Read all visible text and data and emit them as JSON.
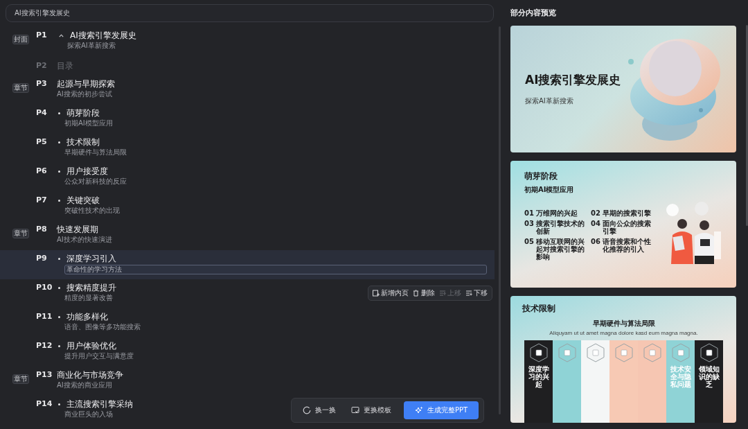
{
  "title_field": {
    "value": "AI搜索引擎发展史"
  },
  "outline": [
    {
      "badge": "封面",
      "page": "P1",
      "kind": "cover",
      "title": "AI搜索引擎发展史",
      "subtitle": "探索AI革新搜索",
      "disabled": false,
      "selected": false
    },
    {
      "page": "P2",
      "kind": "toc",
      "title": "目录",
      "disabled": true,
      "selected": false
    },
    {
      "badge": "章节",
      "page": "P3",
      "kind": "chapter",
      "title": "起源与早期探索",
      "subtitle": "AI搜索的初步尝试",
      "disabled": false,
      "selected": false
    },
    {
      "page": "P4",
      "kind": "section",
      "title": "萌芽阶段",
      "subtitle": "初期AI模型应用",
      "disabled": false,
      "selected": false
    },
    {
      "page": "P5",
      "kind": "section",
      "title": "技术限制",
      "subtitle": "早期硬件与算法局限",
      "disabled": false,
      "selected": false
    },
    {
      "page": "P6",
      "kind": "section",
      "title": "用户接受度",
      "subtitle": "公众对新科技的反应",
      "disabled": false,
      "selected": false
    },
    {
      "page": "P7",
      "kind": "section",
      "title": "关键突破",
      "subtitle": "突破性技术的出现",
      "disabled": false,
      "selected": false
    },
    {
      "badge": "章节",
      "page": "P8",
      "kind": "chapter",
      "title": "快速发展期",
      "subtitle": "AI技术的快速演进",
      "disabled": false,
      "selected": false
    },
    {
      "page": "P9",
      "kind": "section",
      "title": "深度学习引入",
      "subtitle": "革命性的学习方法",
      "disabled": false,
      "selected": true
    },
    {
      "page": "P10",
      "kind": "section",
      "title": "搜索精度提升",
      "subtitle": "精度的显著改善",
      "disabled": false,
      "selected": false
    },
    {
      "page": "P11",
      "kind": "section",
      "title": "功能多样化",
      "subtitle": "语音、图像等多功能搜索",
      "disabled": false,
      "selected": false
    },
    {
      "page": "P12",
      "kind": "section",
      "title": "用户体验优化",
      "subtitle": "提升用户交互与满意度",
      "disabled": false,
      "selected": false
    },
    {
      "badge": "章节",
      "page": "P13",
      "kind": "chapter",
      "title": "商业化与市场竞争",
      "subtitle": "AI搜索的商业应用",
      "disabled": false,
      "selected": false
    },
    {
      "page": "P14",
      "kind": "section",
      "title": "主流搜索引擎采纳",
      "subtitle": "商业巨头的入场",
      "disabled": false,
      "selected": false
    }
  ],
  "row_toolbar": [
    {
      "label": "新增内页",
      "kind": "add",
      "disabled": false
    },
    {
      "label": "删除",
      "kind": "delete",
      "disabled": false
    },
    {
      "label": "上移",
      "kind": "up",
      "disabled": true
    },
    {
      "label": "下移",
      "kind": "down",
      "disabled": false
    }
  ],
  "action_bar": [
    {
      "label": "换一换",
      "kind": "refresh"
    },
    {
      "label": "更换模板",
      "kind": "template"
    },
    {
      "label": "生成完整PPT",
      "kind": "generate"
    }
  ],
  "preview": {
    "title": "部分内容预览",
    "slides": [
      {
        "kind": "cover",
        "title": "AI搜索引擎发展史",
        "subtitle": "探索AI革新搜索"
      },
      {
        "kind": "numbered",
        "title": "萌芽阶段",
        "subtitle": "初期AI模型应用",
        "items": [
          {
            "number": "01",
            "title": "万维网的兴起"
          },
          {
            "number": "02",
            "title": "早期的搜索引擎"
          },
          {
            "number": "03",
            "title": "搜索引擎技术的创新"
          },
          {
            "number": "04",
            "title": "面向公众的搜索引擎"
          },
          {
            "number": "05",
            "title": "移动互联网的兴起对搜索引擎的影响"
          },
          {
            "number": "06",
            "title": "语音搜索和个性化推荐的引入"
          }
        ]
      },
      {
        "kind": "columns",
        "title": "技术限制",
        "subtitle": "早期硬件与算法局限",
        "caption": "Aliquyam ut ut amet magna dolore kasd eum magna magna.",
        "columns": [
          {
            "title": "深度学习的兴起",
            "color": "#1f1f21"
          },
          {
            "color": "#8fd3d6"
          },
          {
            "color": "#f4f6f6"
          },
          {
            "color": "#f7c9b4"
          },
          {
            "color": "#f6c6b2"
          },
          {
            "title": "技术安全与隐私问题",
            "color": "#8fd3d6"
          },
          {
            "title": "领域知识的缺乏",
            "color": "#1f1f21"
          }
        ]
      }
    ]
  }
}
